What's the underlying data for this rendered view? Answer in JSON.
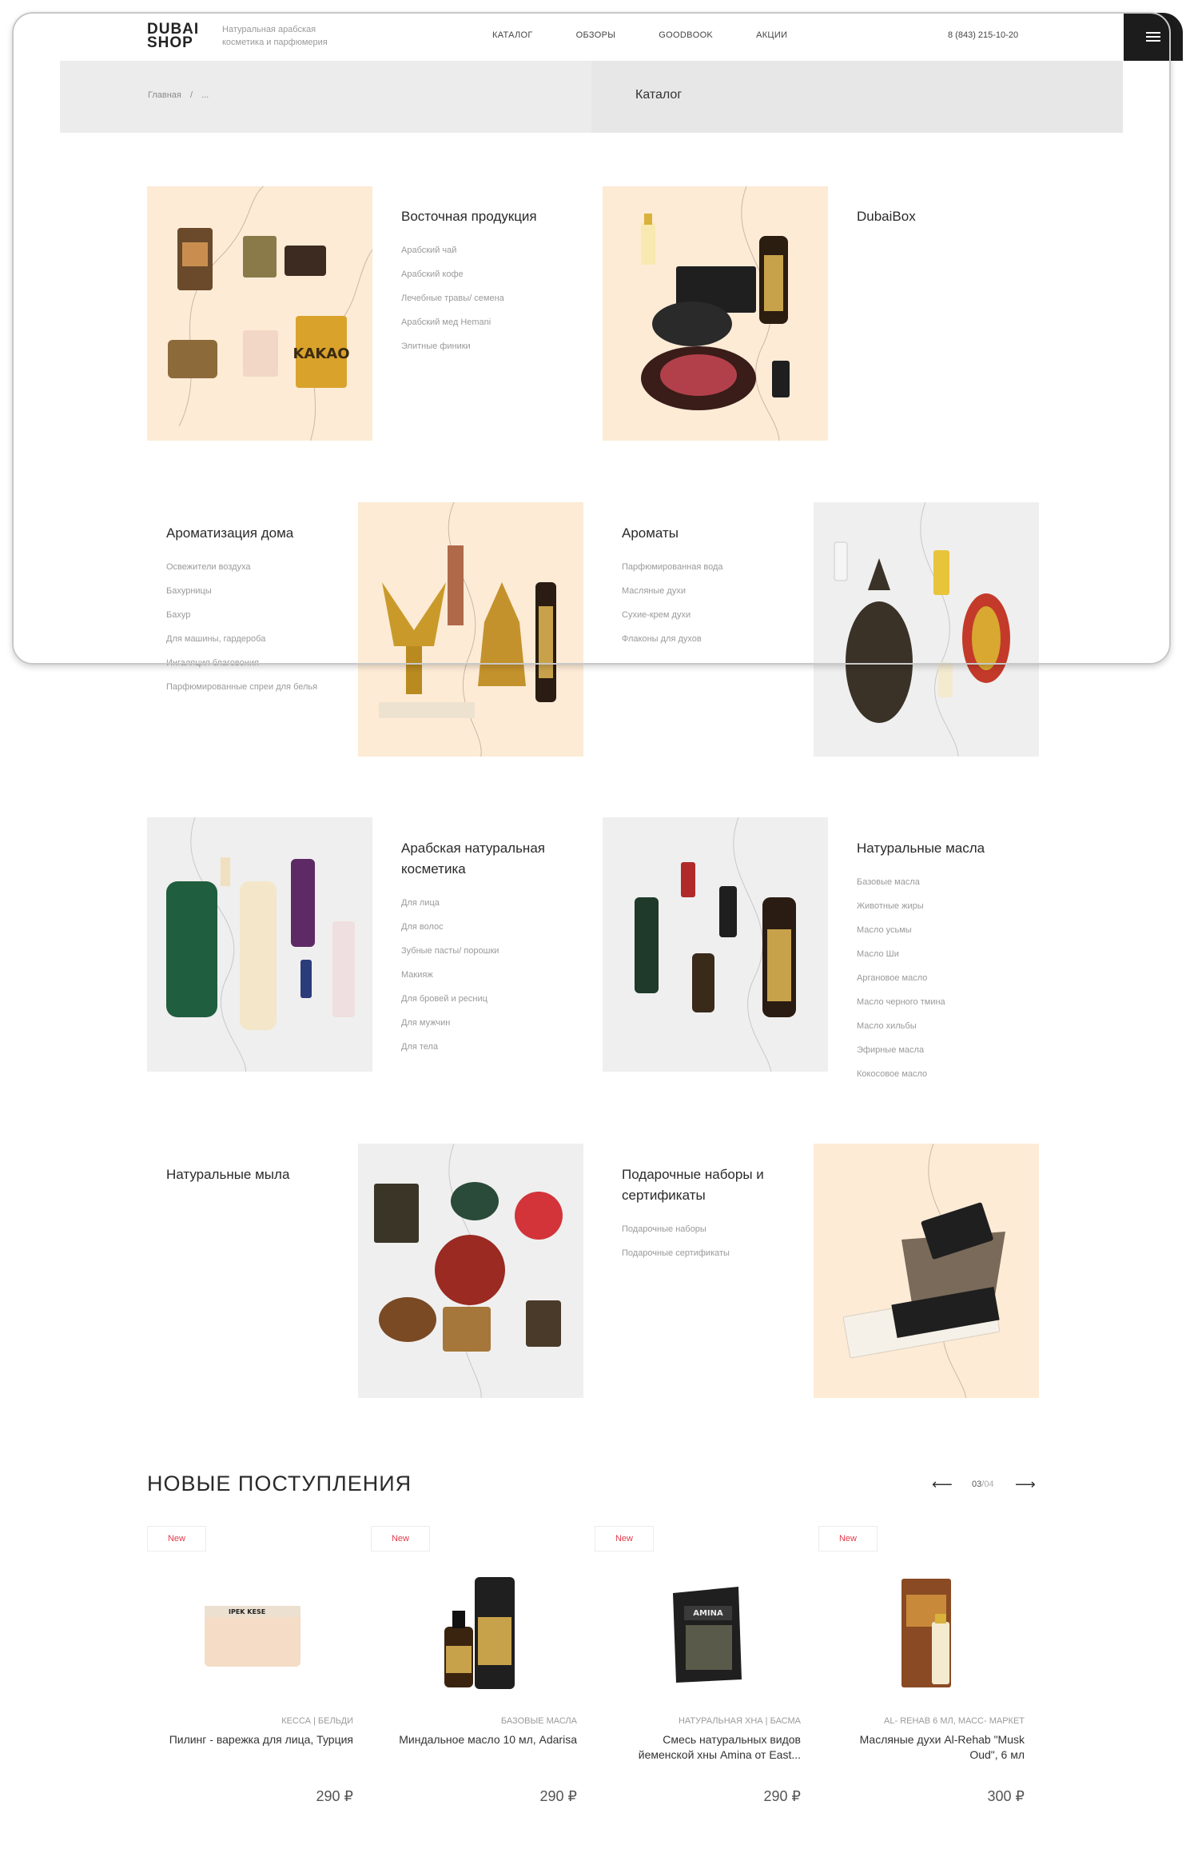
{
  "header": {
    "logo_line1": "DUBAI",
    "logo_line2": "SHOP",
    "tagline": "Натуральная арабская косметика и парфюмерия",
    "nav": [
      "КАТАЛОГ",
      "ОБЗОРЫ",
      "GOODBOOK",
      "АКЦИИ"
    ],
    "phone": "8 (843) 215-10-20",
    "menu_icon": "hamburger-icon"
  },
  "breadcrumb": {
    "home": "Главная",
    "separator": "/",
    "current": "...",
    "page_title": "Каталог"
  },
  "categories": [
    {
      "title": "Восточная продукция",
      "links": [
        "Арабский чай",
        "Арабский кофе",
        "Лечебные травы/ семена",
        "Арабский мед Hemani",
        "Элитные финики"
      ]
    },
    {
      "title": "DubaiBox",
      "links": []
    },
    {
      "title": "Ароматизация дома",
      "links": [
        "Освежители воздуха",
        "Бахурницы",
        "Бахур",
        "Для машины, гардероба",
        "Ингаляция благовония",
        "Парфюмированные спреи для белья"
      ]
    },
    {
      "title": "Ароматы",
      "links": [
        "Парфюмированная вода",
        "Масляные духи",
        "Сухие-крем духи",
        "Флаконы для духов"
      ]
    },
    {
      "title": "Арабская натуральная косметика",
      "links": [
        "Для лица",
        "Для волос",
        "Зубные пасты/ порошки",
        "Макияж",
        "Для бровей и ресниц",
        "Для мужчин",
        "Для тела"
      ]
    },
    {
      "title": "Натуральные масла",
      "links": [
        "Базовые масла",
        "Животные жиры",
        "Масло усьмы",
        "Масло Ши",
        "Аргановое масло",
        "Масло черного тмина",
        "Масло хильбы",
        "Эфирные масла",
        "Кокосовое масло"
      ]
    },
    {
      "title": "Натуральные мыла",
      "links": []
    },
    {
      "title": "Подарочные наборы и сертификаты",
      "links": [
        "Подарочные наборы",
        "Подарочные сертификаты"
      ]
    }
  ],
  "new_arrivals": {
    "title": "НОВЫЕ ПОСТУПЛЕНИЯ",
    "pager_current": "03",
    "pager_sep": "/",
    "pager_total": "04",
    "prev_icon": "arrow-left-icon",
    "next_icon": "arrow-right-icon",
    "products": [
      {
        "badge": "New",
        "category": "КЕССА | БЕЛЬДИ",
        "name": "Пилинг - варежка для лица, Турция",
        "price": "290 ₽"
      },
      {
        "badge": "New",
        "category": "БАЗОВЫЕ МАСЛА",
        "name": "Миндальное масло 10 мл, Adarisa",
        "price": "290 ₽"
      },
      {
        "badge": "New",
        "category": "НАТУРАЛЬНАЯ ХНА | БАСМА",
        "name": "Смесь натуральных видов йеменской хны Amina от East...",
        "price": "290 ₽"
      },
      {
        "badge": "New",
        "category": "AL- REHAB 6 МЛ, МАСС- МАРКЕТ",
        "name": "Масляные духи Al-Rehab \"Musk Oud\", 6 мл",
        "price": "300 ₽"
      }
    ]
  },
  "colors": {
    "cream_bg": "#fdebd6",
    "gray_bg": "#efefef",
    "badge_red": "#e23a4a",
    "burger_bg": "#1c1c1c"
  }
}
